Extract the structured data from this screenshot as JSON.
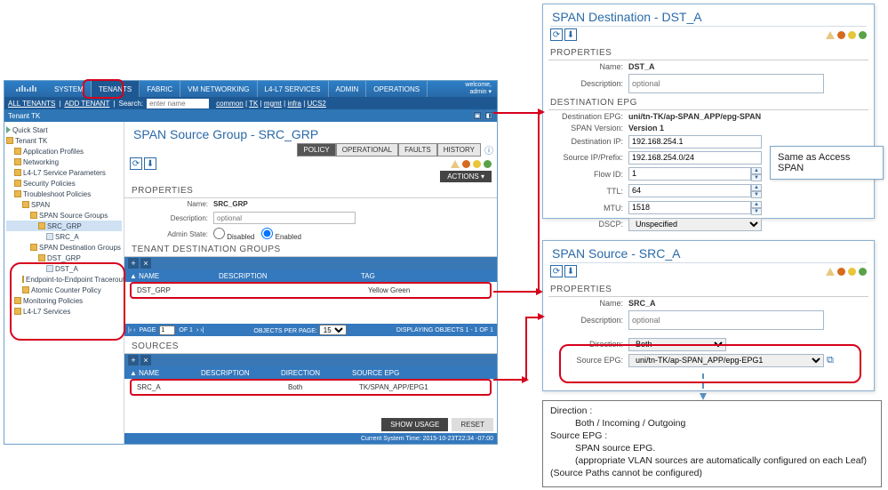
{
  "nav": {
    "items": [
      "SYSTEM",
      "TENANTS",
      "FABRIC",
      "VM NETWORKING",
      "L4-L7 SERVICES",
      "ADMIN",
      "OPERATIONS"
    ],
    "welcome_line1": "welcome,",
    "welcome_line2": "admin ▾"
  },
  "subbar": {
    "all_tenants": "ALL TENANTS",
    "add_tenant": "ADD TENANT",
    "search_label": "Search:",
    "search_ph": "enter name",
    "crumbs": [
      "common",
      "TK",
      "mgmt",
      "infra",
      "UCS2"
    ]
  },
  "tenant_label": "Tenant TK",
  "tree": [
    {
      "i": 0,
      "t": "Quick Start",
      "ic": "play"
    },
    {
      "i": 0,
      "t": "Tenant TK",
      "ic": "folder"
    },
    {
      "i": 1,
      "t": "Application Profiles",
      "ic": "folder"
    },
    {
      "i": 1,
      "t": "Networking",
      "ic": "folder"
    },
    {
      "i": 1,
      "t": "L4-L7 Service Parameters",
      "ic": "folder"
    },
    {
      "i": 1,
      "t": "Security Policies",
      "ic": "folder"
    },
    {
      "i": 1,
      "t": "Troubleshoot Policies",
      "ic": "folder"
    },
    {
      "i": 2,
      "t": "SPAN",
      "ic": "folder"
    },
    {
      "i": 3,
      "t": "SPAN Source Groups",
      "ic": "folder"
    },
    {
      "i": 4,
      "t": "SRC_GRP",
      "ic": "folder",
      "sel": true
    },
    {
      "i": 5,
      "t": "SRC_A",
      "ic": "doc"
    },
    {
      "i": 3,
      "t": "SPAN Destination Groups",
      "ic": "folder"
    },
    {
      "i": 4,
      "t": "DST_GRP",
      "ic": "folder"
    },
    {
      "i": 5,
      "t": "DST_A",
      "ic": "doc"
    },
    {
      "i": 2,
      "t": "Endpoint-to-Endpoint Traceroute Pol…",
      "ic": "folder"
    },
    {
      "i": 2,
      "t": "Atomic Counter Policy",
      "ic": "folder"
    },
    {
      "i": 1,
      "t": "Monitoring Policies",
      "ic": "folder"
    },
    {
      "i": 1,
      "t": "L4-L7 Services",
      "ic": "folder"
    }
  ],
  "main": {
    "title": "SPAN Source Group - SRC_GRP",
    "tabs": [
      "POLICY",
      "OPERATIONAL",
      "FAULTS",
      "HISTORY"
    ],
    "actions": "ACTIONS ▾",
    "info_icon": "ⓘ",
    "props_head": "PROPERTIES",
    "name_lbl": "Name:",
    "name_val": "SRC_GRP",
    "desc_lbl": "Description:",
    "desc_ph": "optional",
    "admin_lbl": "Admin State:",
    "disabled": "Disabled",
    "enabled": "Enabled",
    "tdg_head": "TENANT DESTINATION GROUPS",
    "tdg_cols": [
      "▲ NAME",
      "DESCRIPTION",
      "TAG"
    ],
    "tdg_row": {
      "name": "DST_GRP",
      "desc": "",
      "tag": "Yellow Green"
    },
    "pager": {
      "page_lbl": "PAGE",
      "page": "1",
      "of": "OF 1",
      "opp": "OBJECTS PER PAGE:",
      "opp_val": "15",
      "disp": "DISPLAYING OBJECTS 1 - 1 OF 1"
    },
    "src_head": "SOURCES",
    "src_cols": [
      "▲ NAME",
      "DESCRIPTION",
      "DIRECTION",
      "SOURCE EPG"
    ],
    "src_row": {
      "name": "SRC_A",
      "desc": "",
      "dir": "Both",
      "epg": "TK/SPAN_APP/EPG1"
    },
    "show_usage": "SHOW USAGE",
    "reset": "RESET",
    "sys_time": "Current System Time: 2015-10-23T22:34 -07:00"
  },
  "dest_panel": {
    "title": "SPAN Destination - DST_A",
    "props": "PROPERTIES",
    "name_lbl": "Name:",
    "name": "DST_A",
    "desc_lbl": "Description:",
    "desc_ph": "optional",
    "epg_head": "DESTINATION EPG",
    "depg_lbl": "Destination EPG:",
    "depg": "uni/tn-TK/ap-SPAN_APP/epg-SPAN",
    "ver_lbl": "SPAN Version:",
    "ver": "Version 1",
    "dip_lbl": "Destination IP:",
    "dip": "192.168.254.1",
    "sip_lbl": "Source IP/Prefix:",
    "sip": "192.168.254.0/24",
    "flow_lbl": "Flow ID:",
    "flow": "1",
    "ttl_lbl": "TTL:",
    "ttl": "64",
    "mtu_lbl": "MTU:",
    "mtu": "1518",
    "dscp_lbl": "DSCP:",
    "dscp": "Unspecified"
  },
  "same_label": "Same as Access SPAN",
  "src_panel": {
    "title": "SPAN Source - SRC_A",
    "props": "PROPERTIES",
    "name_lbl": "Name:",
    "name": "SRC_A",
    "desc_lbl": "Description:",
    "desc_ph": "optional",
    "dir_lbl": "Direction:",
    "dir": "Both",
    "sepg_lbl": "Source EPG:",
    "sepg": "uni/tn-TK/ap-SPAN_APP/epg-EPG1"
  },
  "info": {
    "l1": "Direction :",
    "l2": "Both / Incoming / Outgoing",
    "l3": "Source EPG :",
    "l4": "SPAN source EPG.",
    "l5": "(appropriate VLAN sources are automatically configured on each Leaf)",
    "l6": "(Source Paths cannot be configured)"
  }
}
